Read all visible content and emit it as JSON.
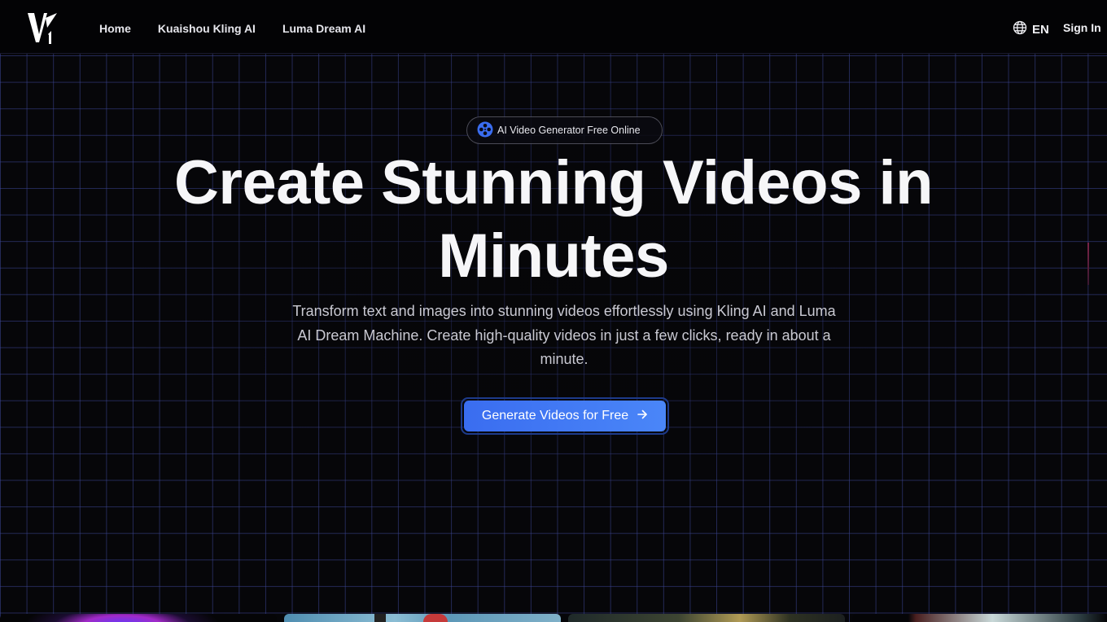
{
  "header": {
    "logo_alt": "V1",
    "nav": [
      {
        "label": "Home"
      },
      {
        "label": "Kuaishou Kling AI"
      },
      {
        "label": "Luma Dream AI"
      }
    ],
    "language": "EN",
    "sign_in": "Sign In"
  },
  "hero": {
    "badge": "AI Video Generator Free Online",
    "title_line1": "Create Stunning Videos in",
    "title_line2": "Minutes",
    "subtitle": "Transform text and images into stunning videos effortlessly using Kling AI and Luma AI Dream Machine. Create high-quality videos in just a few clicks, ready in about a minute.",
    "cta": "Generate Videos for Free"
  },
  "icons": {
    "logo": "v1-logo-icon",
    "language": "globe-icon",
    "badge": "film-reel-icon",
    "cta": "arrow-right-icon"
  },
  "colors": {
    "background": "#050507",
    "grid": "#3c4696",
    "accent": "#3a6df0"
  }
}
